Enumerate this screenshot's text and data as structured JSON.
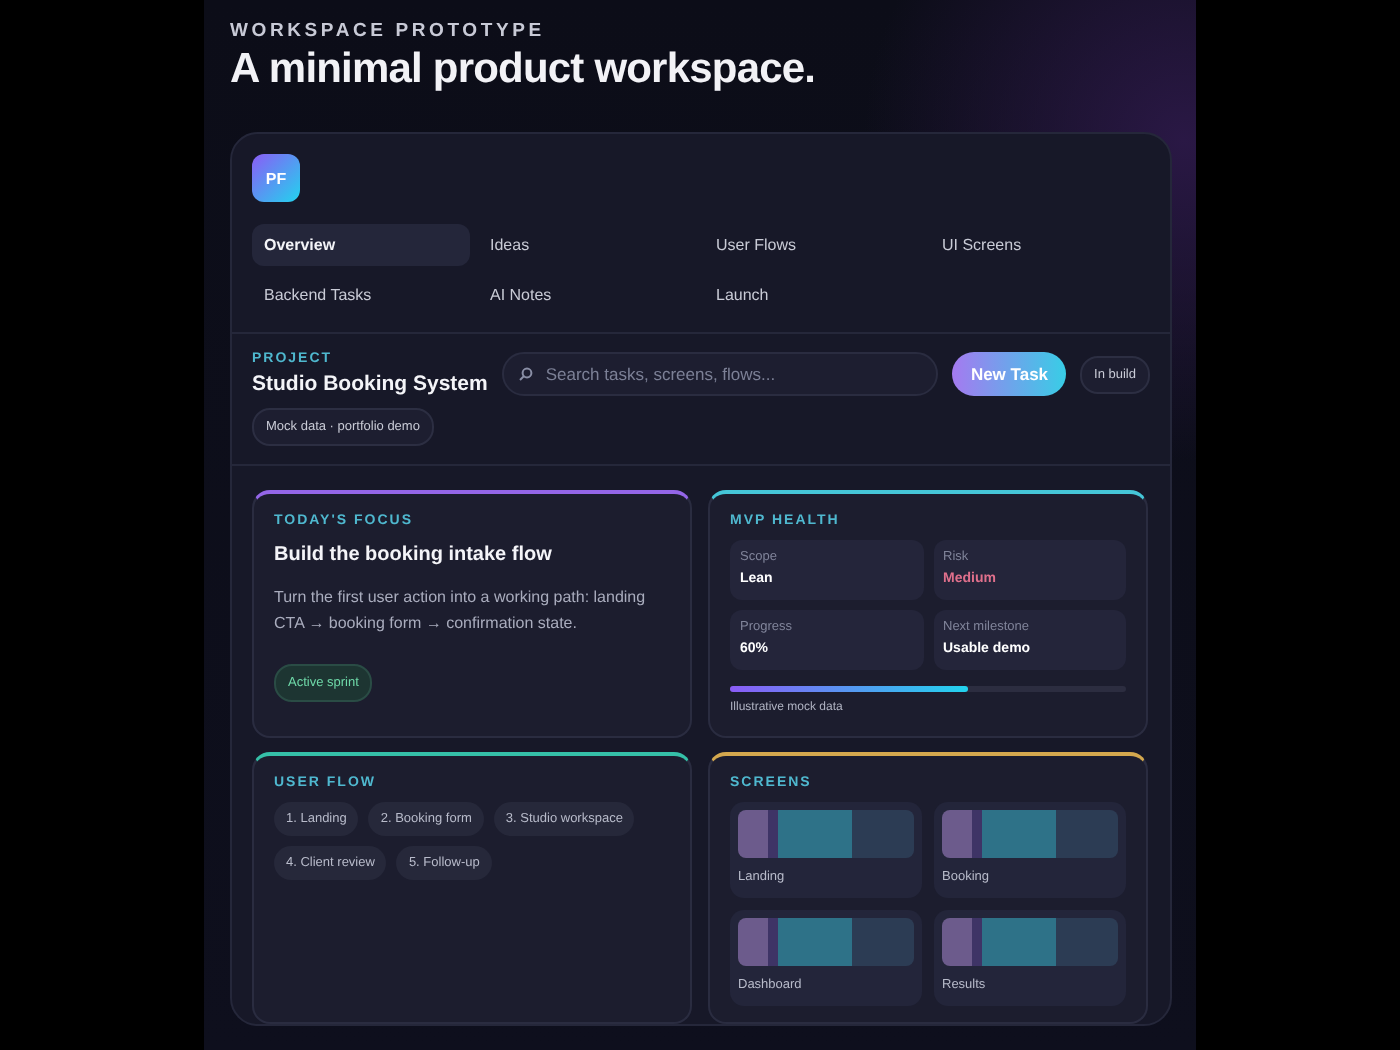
{
  "header": {
    "eyebrow": "WORKSPACE PROTOTYPE",
    "title": "A minimal product workspace."
  },
  "avatar": "PF",
  "tabs": [
    {
      "label": "Overview",
      "selected": true
    },
    {
      "label": "Ideas",
      "selected": false
    },
    {
      "label": "User Flows",
      "selected": false
    },
    {
      "label": "UI Screens",
      "selected": false
    },
    {
      "label": "Backend Tasks",
      "selected": false
    },
    {
      "label": "AI Notes",
      "selected": false
    },
    {
      "label": "Launch",
      "selected": false
    }
  ],
  "project": {
    "label": "PROJECT",
    "name": "Studio Booking System",
    "search_placeholder": "Search tasks, screens, flows...",
    "new_button": "New Task",
    "status": "In build",
    "note": "Mock data · portfolio demo"
  },
  "focus": {
    "label": "TODAY'S FOCUS",
    "title": "Build the booking intake flow",
    "body": "Turn the first user action into a working path: landing CTA → booking form → confirmation state.",
    "tag": "Active sprint"
  },
  "health": {
    "label": "MVP HEALTH",
    "metrics": [
      {
        "name": "Scope",
        "value": "Lean",
        "color": "#ffffff"
      },
      {
        "name": "Risk",
        "value": "Medium",
        "color": "#e0708c"
      },
      {
        "name": "Progress",
        "value": "60%",
        "color": "#ffffff"
      },
      {
        "name": "Next milestone",
        "value": "Usable demo",
        "color": "#ffffff"
      }
    ],
    "level": 0.6,
    "caption": "Illustrative mock data"
  },
  "user_flow": {
    "label": "USER FLOW",
    "steps": [
      "1. Landing",
      "2. Booking form",
      "3. Studio workspace",
      "4. Client review",
      "5. Follow-up"
    ]
  },
  "screens": {
    "label": "SCREENS",
    "items": [
      "Landing",
      "Booking",
      "Dashboard",
      "Results"
    ]
  }
}
